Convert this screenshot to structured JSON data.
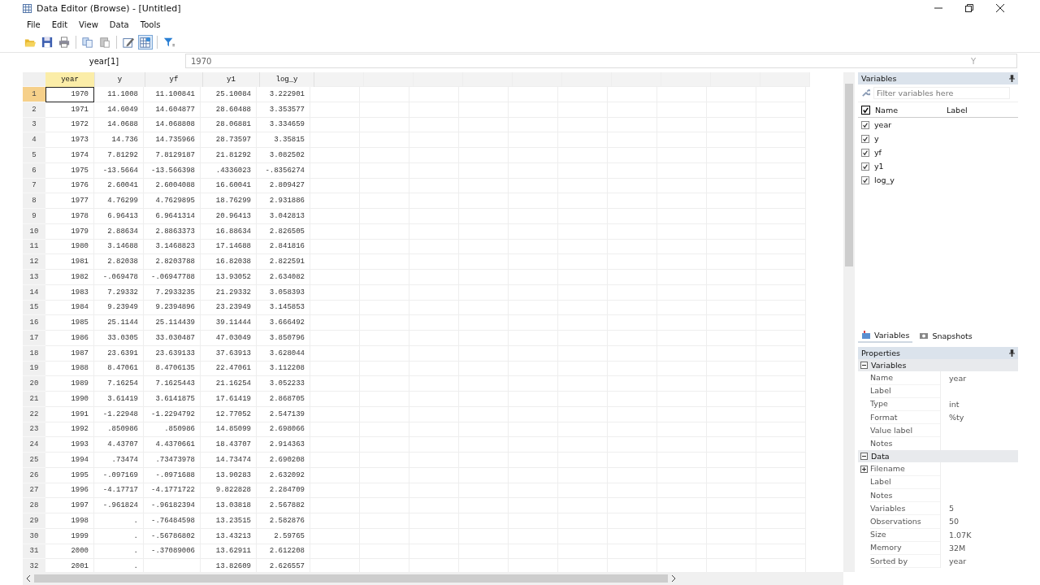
{
  "window": {
    "title": "Data Editor (Browse) - [Untitled]"
  },
  "menu": [
    "File",
    "Edit",
    "View",
    "Data",
    "Tools"
  ],
  "toolbar": [
    {
      "kind": "open",
      "pressed": false
    },
    {
      "kind": "save",
      "pressed": false
    },
    {
      "kind": "print",
      "pressed": false
    },
    {
      "kind": "copy",
      "pressed": false
    },
    {
      "kind": "paste",
      "pressed": false
    },
    {
      "kind": "edit",
      "pressed": false
    },
    {
      "kind": "browse",
      "pressed": true
    },
    {
      "kind": "filter",
      "pressed": false
    }
  ],
  "cell_bar": {
    "cell": "year[1]",
    "value": "1970",
    "right_label": "Y"
  },
  "table": {
    "columns": [
      {
        "name": "year",
        "selected": true
      },
      {
        "name": "y",
        "selected": false
      },
      {
        "name": "yf",
        "selected": false
      },
      {
        "name": "y1",
        "selected": false
      },
      {
        "name": "log_y",
        "selected": false
      }
    ],
    "rows": [
      {
        "n": "1",
        "selected": true,
        "cells": [
          "1970",
          "11.1008",
          "11.100841",
          "25.10084",
          "3.222901"
        ]
      },
      {
        "n": "2",
        "selected": false,
        "cells": [
          "1971",
          "14.6049",
          "14.604877",
          "28.60488",
          "3.353577"
        ]
      },
      {
        "n": "3",
        "selected": false,
        "cells": [
          "1972",
          "14.0688",
          "14.068808",
          "28.06881",
          "3.334659"
        ]
      },
      {
        "n": "4",
        "selected": false,
        "cells": [
          "1973",
          "14.736",
          "14.735966",
          "28.73597",
          "3.35815"
        ]
      },
      {
        "n": "5",
        "selected": false,
        "cells": [
          "1974",
          "7.81292",
          "7.8129187",
          "21.81292",
          "3.082502"
        ]
      },
      {
        "n": "6",
        "selected": false,
        "cells": [
          "1975",
          "-13.5664",
          "-13.566398",
          ".4336023",
          "-.8356274"
        ]
      },
      {
        "n": "7",
        "selected": false,
        "cells": [
          "1976",
          "2.60041",
          "2.6004088",
          "16.60041",
          "2.809427"
        ]
      },
      {
        "n": "8",
        "selected": false,
        "cells": [
          "1977",
          "4.76299",
          "4.7629895",
          "18.76299",
          "2.931886"
        ]
      },
      {
        "n": "9",
        "selected": false,
        "cells": [
          "1978",
          "6.96413",
          "6.9641314",
          "20.96413",
          "3.042813"
        ]
      },
      {
        "n": "10",
        "selected": false,
        "cells": [
          "1979",
          "2.88634",
          "2.8863373",
          "16.88634",
          "2.826505"
        ]
      },
      {
        "n": "11",
        "selected": false,
        "cells": [
          "1980",
          "3.14688",
          "3.1468823",
          "17.14688",
          "2.841816"
        ]
      },
      {
        "n": "12",
        "selected": false,
        "cells": [
          "1981",
          "2.82038",
          "2.8203788",
          "16.82038",
          "2.822591"
        ]
      },
      {
        "n": "13",
        "selected": false,
        "cells": [
          "1982",
          "-.069478",
          "-.06947788",
          "13.93052",
          "2.634082"
        ]
      },
      {
        "n": "14",
        "selected": false,
        "cells": [
          "1983",
          "7.29332",
          "7.2933235",
          "21.29332",
          "3.058393"
        ]
      },
      {
        "n": "15",
        "selected": false,
        "cells": [
          "1984",
          "9.23949",
          "9.2394896",
          "23.23949",
          "3.145853"
        ]
      },
      {
        "n": "16",
        "selected": false,
        "cells": [
          "1985",
          "25.1144",
          "25.114439",
          "39.11444",
          "3.666492"
        ]
      },
      {
        "n": "17",
        "selected": false,
        "cells": [
          "1986",
          "33.0305",
          "33.030487",
          "47.03049",
          "3.850796"
        ]
      },
      {
        "n": "18",
        "selected": false,
        "cells": [
          "1987",
          "23.6391",
          "23.639133",
          "37.63913",
          "3.628044"
        ]
      },
      {
        "n": "19",
        "selected": false,
        "cells": [
          "1988",
          "8.47061",
          "8.4706135",
          "22.47061",
          "3.112208"
        ]
      },
      {
        "n": "20",
        "selected": false,
        "cells": [
          "1989",
          "7.16254",
          "7.1625443",
          "21.16254",
          "3.052233"
        ]
      },
      {
        "n": "21",
        "selected": false,
        "cells": [
          "1990",
          "3.61419",
          "3.6141875",
          "17.61419",
          "2.868705"
        ]
      },
      {
        "n": "22",
        "selected": false,
        "cells": [
          "1991",
          "-1.22948",
          "-1.2294792",
          "12.77052",
          "2.547139"
        ]
      },
      {
        "n": "23",
        "selected": false,
        "cells": [
          "1992",
          ".850986",
          ".850986",
          "14.85099",
          "2.698066"
        ]
      },
      {
        "n": "24",
        "selected": false,
        "cells": [
          "1993",
          "4.43707",
          "4.4370661",
          "18.43707",
          "2.914363"
        ]
      },
      {
        "n": "25",
        "selected": false,
        "cells": [
          "1994",
          ".73474",
          ".73473978",
          "14.73474",
          "2.690208"
        ]
      },
      {
        "n": "26",
        "selected": false,
        "cells": [
          "1995",
          "-.097169",
          "-.0971688",
          "13.90283",
          "2.632092"
        ]
      },
      {
        "n": "27",
        "selected": false,
        "cells": [
          "1996",
          "-4.17717",
          "-4.1771722",
          "9.822828",
          "2.284709"
        ]
      },
      {
        "n": "28",
        "selected": false,
        "cells": [
          "1997",
          "-.961824",
          "-.96182394",
          "13.03818",
          "2.567882"
        ]
      },
      {
        "n": "29",
        "selected": false,
        "cells": [
          "1998",
          ".",
          "-.76484598",
          "13.23515",
          "2.582876"
        ]
      },
      {
        "n": "30",
        "selected": false,
        "cells": [
          "1999",
          ".",
          "-.56786802",
          "13.43213",
          "2.59765"
        ]
      },
      {
        "n": "31",
        "selected": false,
        "cells": [
          "2000",
          ".",
          "-.37089006",
          "13.62911",
          "2.612208"
        ]
      },
      {
        "n": "32",
        "selected": false,
        "cells": [
          "2001",
          ".",
          null,
          "13.82609",
          "2.626557"
        ]
      }
    ]
  },
  "variables_panel": {
    "title": "Variables",
    "filter_placeholder": "Filter variables here",
    "all_checked": true,
    "columns": [
      "Name",
      "Label"
    ],
    "items": [
      {
        "name": "year",
        "checked": true
      },
      {
        "name": "y",
        "checked": true
      },
      {
        "name": "yf",
        "checked": true
      },
      {
        "name": "y1",
        "checked": true
      },
      {
        "name": "log_y",
        "checked": true
      }
    ],
    "tabs": [
      {
        "label": "Variables",
        "selected": true
      },
      {
        "label": "Snapshots",
        "selected": false
      }
    ]
  },
  "properties_panel": {
    "title": "Properties",
    "sections": [
      {
        "title": "Variables",
        "expanded": true,
        "rows": [
          {
            "label": "Name",
            "value": "year",
            "expandable": false
          },
          {
            "label": "Label",
            "value": "",
            "expandable": false
          },
          {
            "label": "Type",
            "value": "int",
            "expandable": false
          },
          {
            "label": "Format",
            "value": "%ty",
            "expandable": false
          },
          {
            "label": "Value label",
            "value": "",
            "expandable": false
          },
          {
            "label": "Notes",
            "value": "",
            "expandable": false
          }
        ]
      },
      {
        "title": "Data",
        "expanded": true,
        "rows": [
          {
            "label": "Filename",
            "value": "",
            "expandable": true
          },
          {
            "label": "Label",
            "value": "",
            "expandable": false
          },
          {
            "label": "Notes",
            "value": "",
            "expandable": false
          },
          {
            "label": "Variables",
            "value": "5",
            "expandable": false
          },
          {
            "label": "Observations",
            "value": "50",
            "expandable": false
          },
          {
            "label": "Size",
            "value": "1.07K",
            "expandable": false
          },
          {
            "label": "Memory",
            "value": "32M",
            "expandable": false
          },
          {
            "label": "Sorted by",
            "value": "year",
            "expandable": false
          }
        ]
      }
    ]
  }
}
